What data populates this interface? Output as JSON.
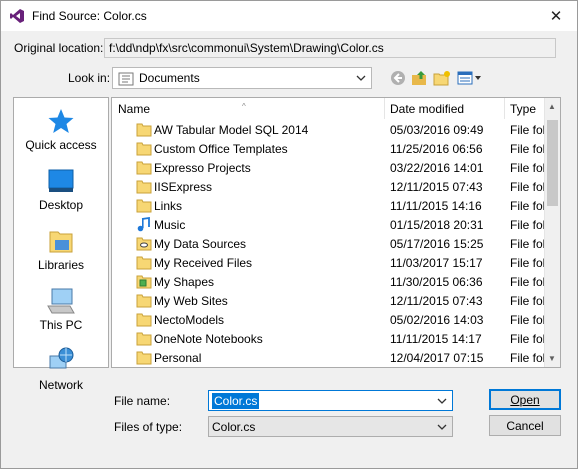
{
  "window": {
    "title": "Find Source: Color.cs",
    "close_glyph": "✕"
  },
  "original_location": {
    "label": "Original location:",
    "value": "f:\\dd\\ndp\\fx\\src\\commonui\\System\\Drawing\\Color.cs"
  },
  "look_in": {
    "label": "Look in:",
    "value": "Documents"
  },
  "places": [
    {
      "label": "Quick access",
      "icon": "star-icon"
    },
    {
      "label": "Desktop",
      "icon": "desktop-icon"
    },
    {
      "label": "Libraries",
      "icon": "libraries-icon"
    },
    {
      "label": "This PC",
      "icon": "computer-icon"
    },
    {
      "label": "Network",
      "icon": "network-icon"
    }
  ],
  "columns": {
    "name": "Name",
    "date": "Date modified",
    "type": "Type"
  },
  "rows": [
    {
      "name": "AW Tabular Model SQL 2014",
      "date": "05/03/2016 09:49",
      "type": "File folder",
      "icon": "folder-icon"
    },
    {
      "name": "Custom Office Templates",
      "date": "11/25/2016 06:56",
      "type": "File folder",
      "icon": "folder-icon"
    },
    {
      "name": "Expresso Projects",
      "date": "03/22/2016 14:01",
      "type": "File folder",
      "icon": "folder-icon"
    },
    {
      "name": "IISExpress",
      "date": "12/11/2015 07:43",
      "type": "File folder",
      "icon": "folder-icon"
    },
    {
      "name": "Links",
      "date": "11/11/2015 14:16",
      "type": "File folder",
      "icon": "folder-icon"
    },
    {
      "name": "Music",
      "date": "01/15/2018 20:31",
      "type": "File folder",
      "icon": "music-icon"
    },
    {
      "name": "My Data Sources",
      "date": "05/17/2016 15:25",
      "type": "File folder",
      "icon": "data-sources-icon"
    },
    {
      "name": "My Received Files",
      "date": "11/03/2017 15:17",
      "type": "File folder",
      "icon": "folder-icon"
    },
    {
      "name": "My Shapes",
      "date": "11/30/2015 06:36",
      "type": "File folder",
      "icon": "shapes-icon"
    },
    {
      "name": "My Web Sites",
      "date": "12/11/2015 07:43",
      "type": "File folder",
      "icon": "folder-icon"
    },
    {
      "name": "NectoModels",
      "date": "05/02/2016 14:03",
      "type": "File folder",
      "icon": "folder-icon"
    },
    {
      "name": "OneNote Notebooks",
      "date": "11/11/2015 14:17",
      "type": "File folder",
      "icon": "folder-icon"
    },
    {
      "name": "Personal",
      "date": "12/04/2017 07:15",
      "type": "File folder",
      "icon": "folder-icon"
    }
  ],
  "file_name": {
    "label": "File name:",
    "value": "Color.cs"
  },
  "file_type": {
    "label": "Files of type:",
    "value": "Color.cs"
  },
  "buttons": {
    "open": "Open",
    "cancel": "Cancel"
  },
  "colors": {
    "accent": "#0078d7",
    "folder": "#f7d774"
  }
}
